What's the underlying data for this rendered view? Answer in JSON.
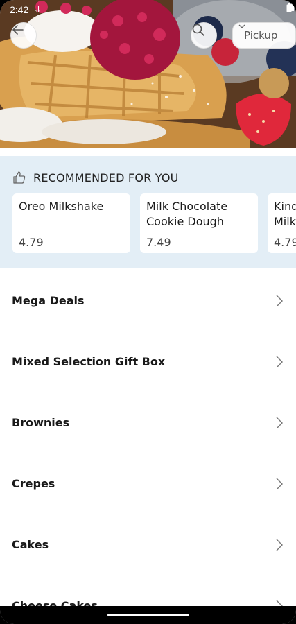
{
  "status": {
    "time": "2:42",
    "mini": "⥥"
  },
  "header": {
    "pickup_label": "Pickup"
  },
  "recommended": {
    "title": "RECOMMENDED FOR YOU",
    "items": [
      {
        "name": "Oreo Milkshake",
        "price": "4.79"
      },
      {
        "name": "Milk Chocolate Cookie Dough",
        "price": "7.49"
      },
      {
        "name": "Kind Milk",
        "price": "4.79"
      }
    ]
  },
  "categories": [
    {
      "label": "Mega Deals"
    },
    {
      "label": "Mixed Selection Gift Box"
    },
    {
      "label": "Brownies"
    },
    {
      "label": "Crepes"
    },
    {
      "label": "Cakes"
    },
    {
      "label": "Cheese Cakes"
    }
  ],
  "icons": {
    "back": "arrow-left-icon",
    "search": "search-icon",
    "thumbs": "thumbs-up-icon",
    "chevron": "chevron-right-icon"
  },
  "colors": {
    "rec_bg": "#e3eef6",
    "divider": "#ececec"
  }
}
